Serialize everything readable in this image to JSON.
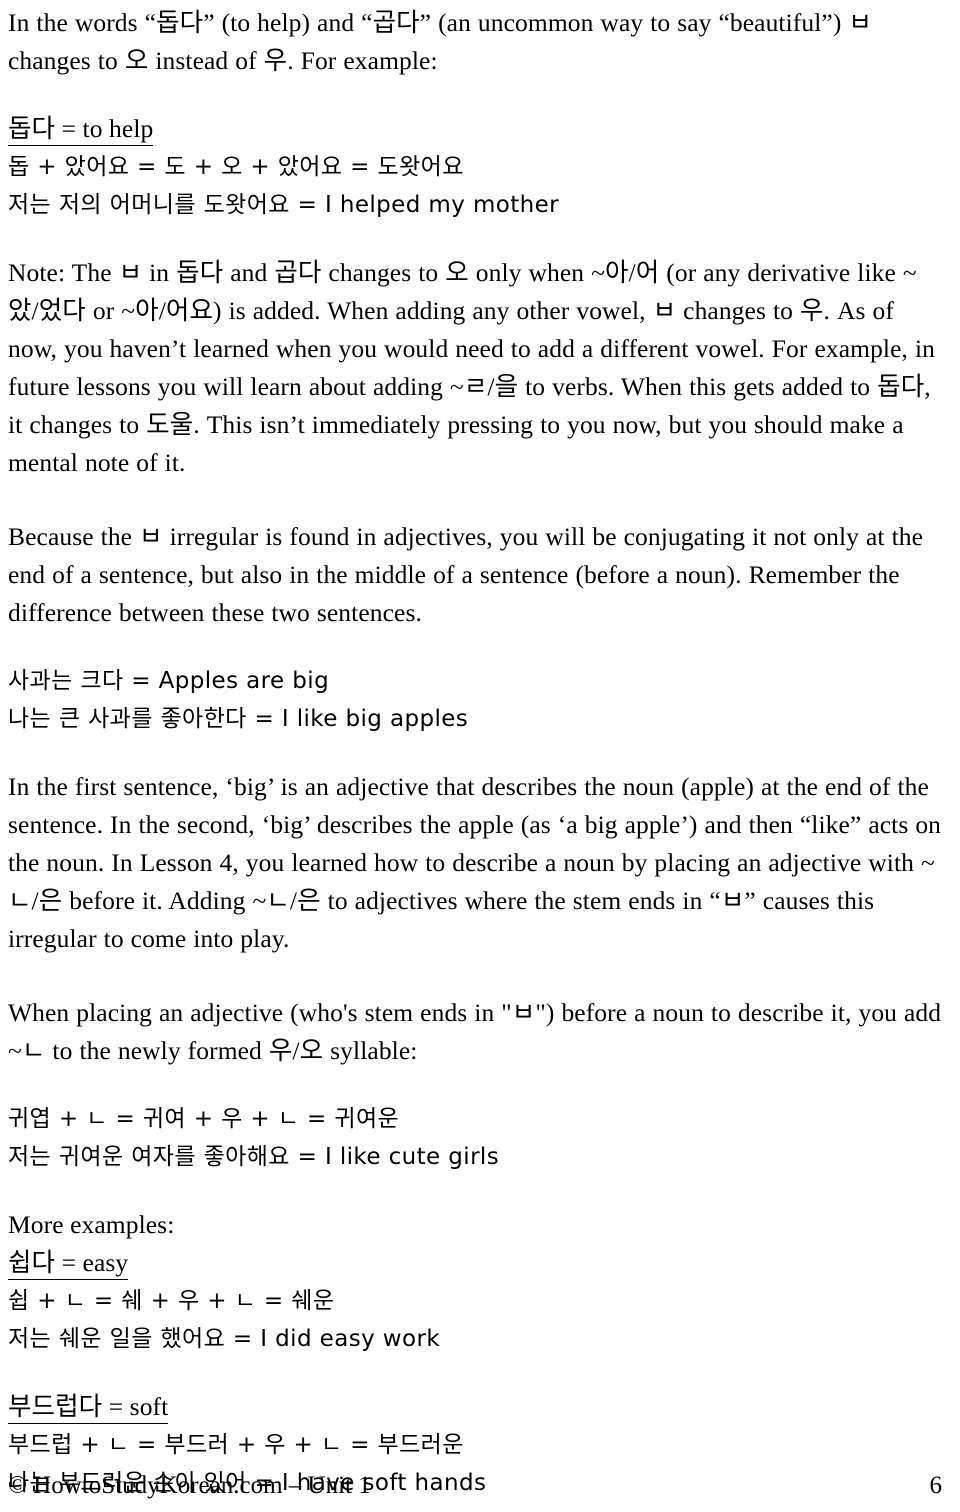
{
  "document": {
    "type": "korean-grammar-lesson-page",
    "page_number": "6"
  },
  "body": {
    "intro_paragraph": "In the words “돕다” (to help) and “곱다” (an uncommon way to say “beautiful”) ㅂ changes to 오 instead of 우. For example:",
    "example_help": {
      "headword": "돕다 = to help",
      "breakdown": "돕 + 았어요 = 도 + 오 + 았어요 = 도왓어요",
      "sentence": "저는 저의 어머니를 도왓어요 = I helped my mother"
    },
    "note_paragraph": "Note: The ㅂ in 돕다 and 곱다 changes to 오 only when ~아/어 (or any derivative like ~았/었다 or ~아/어요) is added. When adding any other vowel, ㅂ changes to 우. As of now, you haven’t learned when you would need to add a different vowel. For example, in future lessons you will learn about adding ~ㄹ/을 to verbs. When this gets added to 돕다, it changes to 도울. This isn’t immediately pressing to you now, but you should make a mental note of it.",
    "because_paragraph": "Because the ㅂ  irregular is found in adjectives, you will be conjugating it not only at the end of a sentence, but also in the middle of a sentence (before a noun). Remember the difference between these two sentences.",
    "apple_examples": {
      "line1": "사과는 크다 = Apples are big",
      "line2": "나는 큰 사과를 좋아한다 = I like big apples"
    },
    "first_sentence_paragraph": "In the first sentence, ‘big’ is an adjective that describes the noun (apple) at the end of the sentence. In the second, ‘big’ describes the apple (as ‘a big apple’) and then “like” acts on the noun. In Lesson 4, you learned how to describe a noun by placing an adjective with ~ㄴ/은 before it. Adding ~ㄴ/은 to adjectives where the stem ends in “ㅂ” causes this irregular to come into play.",
    "when_placing_paragraph": "When placing an adjective (who's stem ends in \"ㅂ\")  before a noun to describe it, you add ~ㄴ to the newly formed 우/오 syllable:",
    "cute_example": {
      "breakdown": "귀엽 + ㄴ = 귀여 + 우 + ㄴ = 귀여운",
      "sentence": "저는 귀여운 여자를 좋아해요 = I like cute girls"
    },
    "more_examples_label": "More examples:",
    "easy_example": {
      "headword": "쉽다 = easy",
      "breakdown": "쉽 + ㄴ = 쉐 + 우 + ㄴ = 쉐운",
      "sentence": "저는 쉐운 일을 했어요 = I did easy work"
    },
    "soft_example": {
      "headword": "부드럽다 = soft",
      "breakdown": "부드럽 + ㄴ = 부드러 + 우 + ㄴ = 부드러운",
      "sentence": "나는 부드러운 손이 있어 = I have soft hands"
    }
  },
  "footer": {
    "copyright": "© HowtoStudyKorean.com – Unit 1",
    "page_number": "6"
  }
}
